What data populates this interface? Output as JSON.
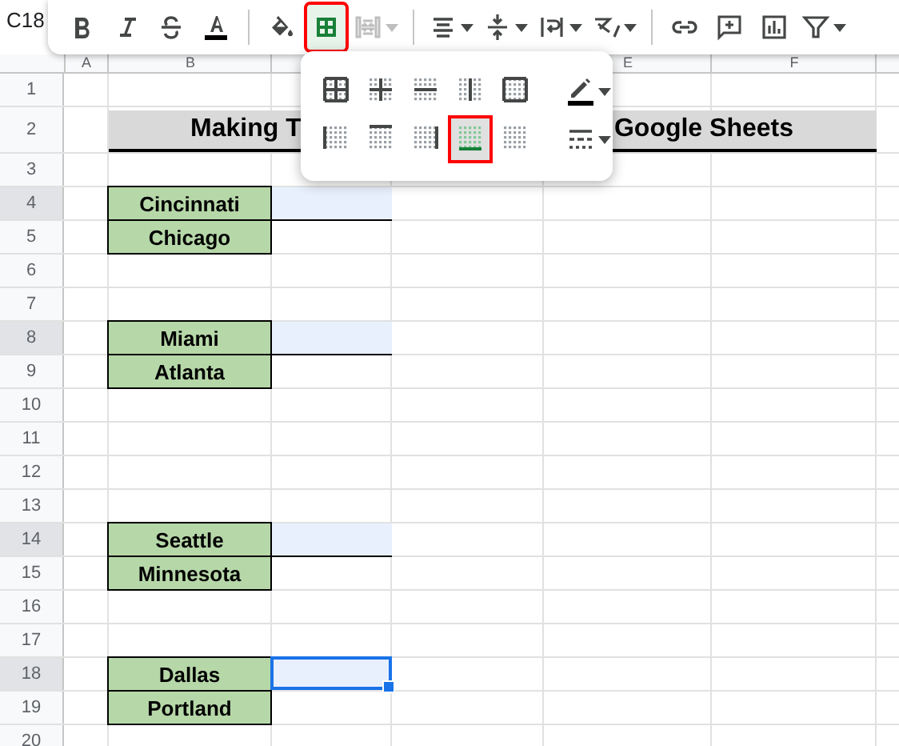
{
  "name_box": "C18",
  "toolbar": {
    "borders_selected": true,
    "merge_disabled": true
  },
  "border_menu": {
    "options": [
      {
        "selected": false
      },
      {
        "selected": false
      },
      {
        "selected": false
      },
      {
        "selected": false
      },
      {
        "selected": false
      },
      {
        "selected": false
      },
      {
        "selected": false
      },
      {
        "selected": false
      },
      {
        "selected": true
      },
      {
        "selected": false
      }
    ]
  },
  "column_headers": [
    "A",
    "B",
    "E",
    "F"
  ],
  "rows": [
    {
      "number": "1",
      "selected": false
    },
    {
      "number": "2",
      "selected": false,
      "title_left": "Making T",
      "title_right": "Google Sheets"
    },
    {
      "number": "3",
      "selected": false
    },
    {
      "number": "4",
      "selected": true,
      "city": "Cincinnati",
      "c_border_bottom": true
    },
    {
      "number": "5",
      "selected": false,
      "city": "Chicago"
    },
    {
      "number": "6",
      "selected": false
    },
    {
      "number": "7",
      "selected": false
    },
    {
      "number": "8",
      "selected": true,
      "city": "Miami",
      "c_border_bottom": true
    },
    {
      "number": "9",
      "selected": false,
      "city": "Atlanta"
    },
    {
      "number": "10",
      "selected": false
    },
    {
      "number": "11",
      "selected": false
    },
    {
      "number": "12",
      "selected": false
    },
    {
      "number": "13",
      "selected": false
    },
    {
      "number": "14",
      "selected": true,
      "city": "Seattle",
      "c_border_bottom": true
    },
    {
      "number": "15",
      "selected": false,
      "city": "Minnesota"
    },
    {
      "number": "16",
      "selected": false
    },
    {
      "number": "17",
      "selected": false
    },
    {
      "number": "18",
      "selected": true,
      "city": "Dallas",
      "active": true
    },
    {
      "number": "19",
      "selected": false,
      "city": "Portland"
    },
    {
      "number": "20",
      "selected": false
    }
  ]
}
